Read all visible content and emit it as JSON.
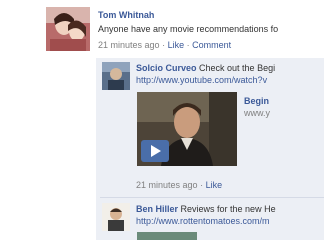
{
  "post": {
    "author": "Tom Whitnah",
    "text": "Anyone have any movie recommendations fo",
    "time": "21 minutes ago",
    "sep1": "·",
    "like": "Like",
    "sep2": "·",
    "comment": "Comment"
  },
  "comments": [
    {
      "author": "Solcio Curveo",
      "text": "Check out the Begi",
      "url": "http://www.youtube.com/watch?v",
      "link_title": "Begin",
      "link_domain": "www.y",
      "time": "21 minutes ago",
      "sep": "·",
      "like": "Like"
    },
    {
      "author": "Ben Hiller",
      "text": "Reviews for the new He",
      "url": "http://www.rottentomatoes.com/m"
    }
  ],
  "colors": {
    "link": "#3b5998",
    "meta": "#808080",
    "thread_bg": "#eceff5"
  }
}
